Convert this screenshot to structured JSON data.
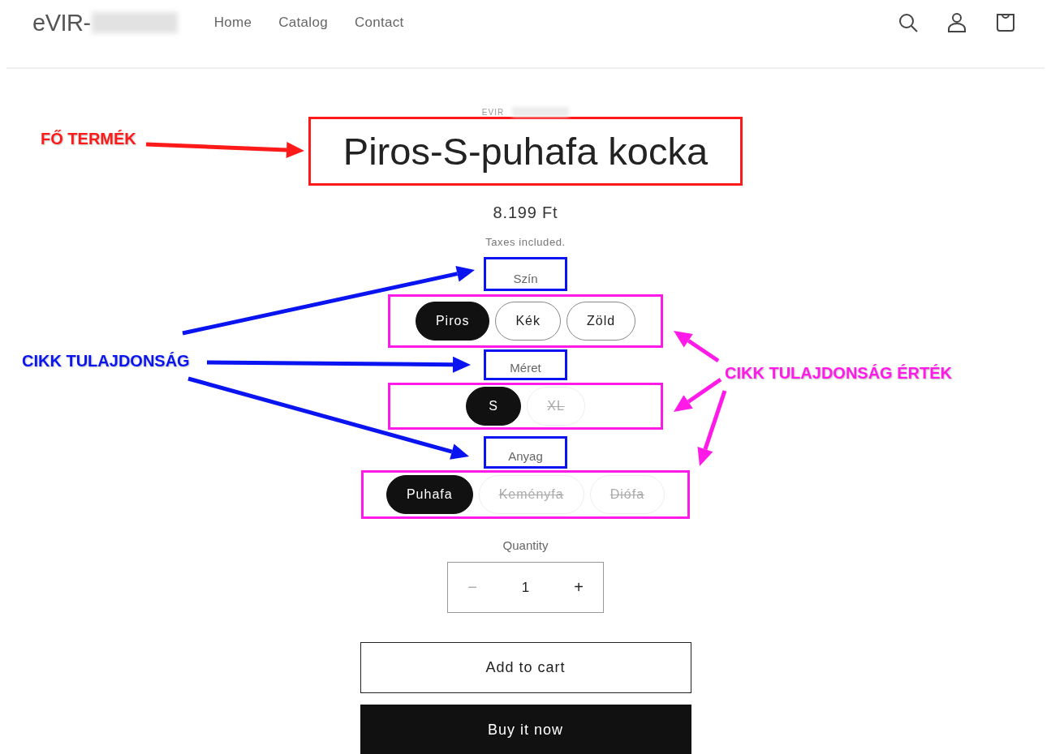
{
  "header": {
    "logo": "eVIR-",
    "nav": [
      {
        "label": "Home"
      },
      {
        "label": "Catalog"
      },
      {
        "label": "Contact"
      }
    ]
  },
  "product": {
    "vendor": "EVIR",
    "title": "Piros-S-puhafa kocka",
    "price": "8.199 Ft",
    "tax_note": "Taxes included.",
    "options": [
      {
        "name": "Szín",
        "values": [
          {
            "label": "Piros",
            "selected": true,
            "disabled": false
          },
          {
            "label": "Kék",
            "selected": false,
            "disabled": false
          },
          {
            "label": "Zöld",
            "selected": false,
            "disabled": false
          }
        ]
      },
      {
        "name": "Méret",
        "values": [
          {
            "label": "S",
            "selected": true,
            "disabled": false
          },
          {
            "label": "XL",
            "selected": false,
            "disabled": true
          }
        ]
      },
      {
        "name": "Anyag",
        "values": [
          {
            "label": "Puhafa",
            "selected": true,
            "disabled": false
          },
          {
            "label": "Keményfa",
            "selected": false,
            "disabled": true
          },
          {
            "label": "Diófa",
            "selected": false,
            "disabled": true
          }
        ]
      }
    ],
    "quantity": {
      "label": "Quantity",
      "minus": "−",
      "value": "1",
      "plus": "+"
    },
    "add_to_cart": "Add to cart",
    "buy_now": "Buy it now"
  },
  "annotations": [
    {
      "label": "FŐ TERMÉK",
      "color": "#ff1a1a"
    },
    {
      "label": "CIKK TULAJDONSÁG",
      "color": "#0a14f0"
    },
    {
      "label": "CIKK TULAJDONSÁG ÉRTÉK",
      "color": "#ff1ae8"
    }
  ]
}
